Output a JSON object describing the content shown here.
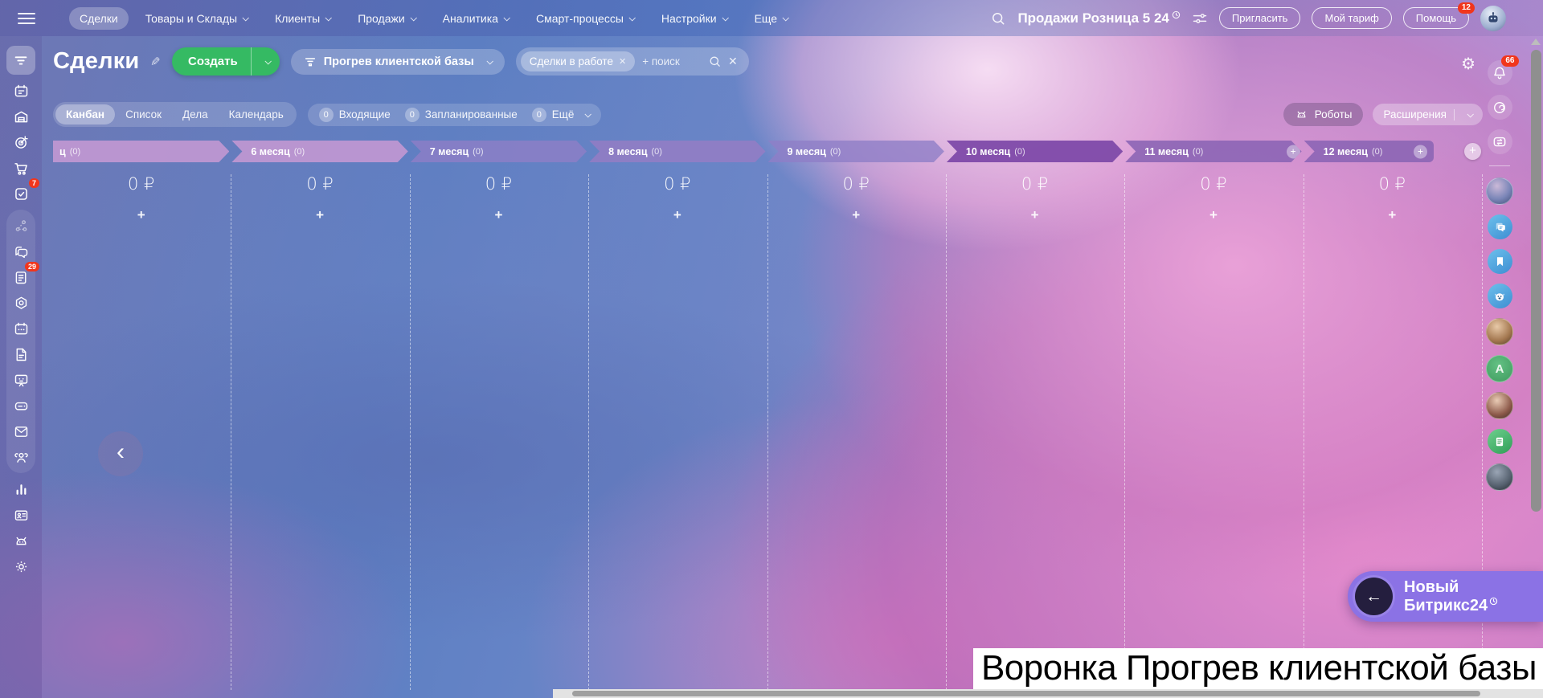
{
  "topbar": {
    "menu": [
      {
        "label": "Сделки"
      },
      {
        "label": "Товары и Склады"
      },
      {
        "label": "Клиенты"
      },
      {
        "label": "Продажи"
      },
      {
        "label": "Аналитика"
      },
      {
        "label": "Смарт-процессы"
      },
      {
        "label": "Настройки"
      },
      {
        "label": "Еще"
      }
    ],
    "portal_title": "Продажи Розница 5 24",
    "invite": "Пригласить",
    "tariff": "Мой тариф",
    "help": "Помощь",
    "help_badge": "12"
  },
  "header": {
    "title": "Сделки",
    "create": "Создать",
    "funnel": "Прогрев клиентской базы",
    "filter_chip": "Сделки в работе",
    "chip_close": "✕",
    "search_placeholder": "+ поиск"
  },
  "views": {
    "tabs": [
      "Канбан",
      "Список",
      "Дела",
      "Календарь"
    ],
    "active_tab": "Канбан",
    "counters": [
      {
        "count": "0",
        "label": "Входящие"
      },
      {
        "count": "0",
        "label": "Запланированные"
      },
      {
        "count": "0",
        "label": "Ещё"
      }
    ],
    "robots": "Роботы",
    "extensions": "Расширения"
  },
  "kanban": {
    "columns": [
      {
        "title": "ц",
        "count": "(0)",
        "sum": "0 ₽"
      },
      {
        "title": "6 месяц",
        "count": "(0)",
        "sum": "0 ₽"
      },
      {
        "title": "7 месяц",
        "count": "(0)",
        "sum": "0 ₽"
      },
      {
        "title": "8 месяц",
        "count": "(0)",
        "sum": "0 ₽"
      },
      {
        "title": "9 месяц",
        "count": "(0)",
        "sum": "0 ₽"
      },
      {
        "title": "10 месяц",
        "count": "(0)",
        "sum": "0 ₽"
      },
      {
        "title": "11 месяц",
        "count": "(0)",
        "sum": "0 ₽"
      },
      {
        "title": "12 месяц",
        "count": "(0)",
        "sum": "0 ₽"
      }
    ],
    "add_card": "+",
    "add_stage": "+",
    "nav_left": "‹"
  },
  "sidebar": {
    "tasks_badge": "7",
    "feed_badge": "29"
  },
  "right_rail": {
    "bell_badge": "66",
    "avatar_letter": "A"
  },
  "promo": {
    "line1": "Новый",
    "line2": "Битрикс24",
    "arrow": "←"
  },
  "caption": "Воронка Прогрев клиентской базы",
  "colors": {
    "accent_green": "#35ba63",
    "badge_red": "#f1361c",
    "promo_purple": "#8b72e5",
    "column_pink": "rgba(197,152,211,0.88)",
    "column_blue": "rgba(143,126,199,0.80)",
    "column_selected": "rgba(126,74,169,0.95)"
  }
}
